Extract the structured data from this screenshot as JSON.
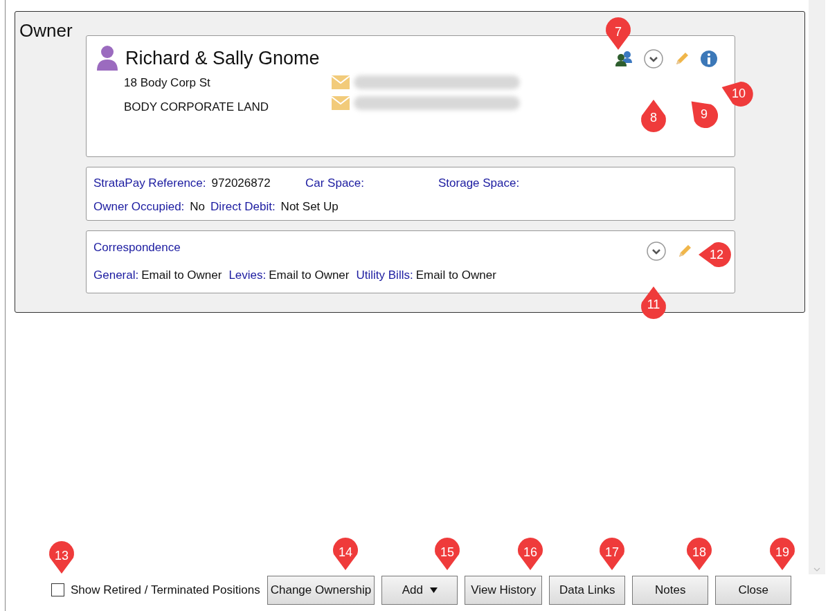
{
  "section": {
    "title": "Owner"
  },
  "contact": {
    "name": "Richard & Sally Gnome",
    "address": [
      "18 Body Corp St",
      "BODY CORPORATE LAND"
    ],
    "emails": [
      {
        "kind": "blurred"
      },
      {
        "kind": "blurred"
      }
    ]
  },
  "details": {
    "rows": [
      [
        {
          "label": "StrataPay Reference:",
          "value": "972026872"
        },
        {
          "label": "Car Space:"
        },
        {
          "label": "Storage Space:"
        }
      ],
      [
        {
          "label": "Owner Occupied:",
          "value": "No"
        },
        {
          "label": "Direct Debit:",
          "value": "Not Set Up"
        }
      ]
    ]
  },
  "correspondence": {
    "title": "Correspondence",
    "items": [
      {
        "label": "General:",
        "value": "Email to Owner"
      },
      {
        "label": "Levies:",
        "value": "Email to Owner"
      },
      {
        "label": "Utility Bills:",
        "value": "Email to Owner"
      }
    ]
  },
  "show_retired": {
    "label": "Show Retired / Terminated Positions",
    "checked": false
  },
  "buttons": [
    {
      "label": "Change Ownership",
      "kind": "plain"
    },
    {
      "label": "Add",
      "kind": "dropdown"
    },
    {
      "label": "View History",
      "kind": "plain"
    },
    {
      "label": "Data Links",
      "kind": "plain"
    },
    {
      "label": "Notes",
      "kind": "plain"
    },
    {
      "label": "Close",
      "kind": "plain"
    }
  ],
  "callouts": [
    "7",
    "8",
    "9",
    "10",
    "11",
    "12",
    "13",
    "14",
    "15",
    "16",
    "17",
    "18",
    "19"
  ]
}
